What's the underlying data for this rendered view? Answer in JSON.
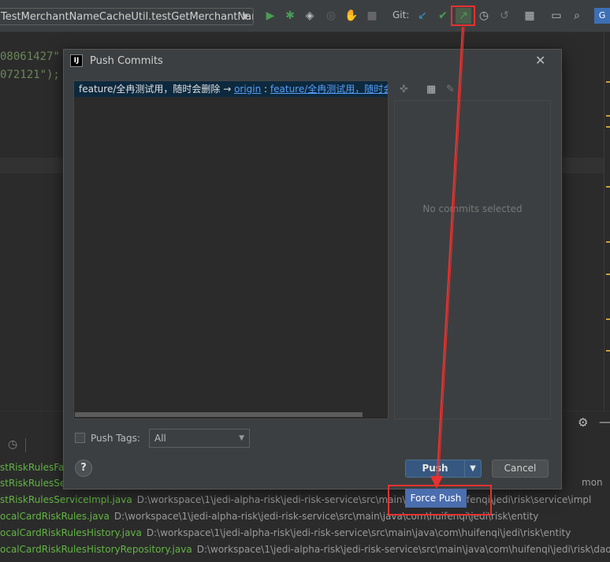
{
  "toolbar": {
    "run_config": "TestMerchantNameCacheUtil.testGetMerchantName",
    "git_label": "Git:",
    "icons": [
      "run-icon",
      "debug-icon",
      "coverage-icon",
      "profile-icon",
      "attach-icon",
      "stop-icon",
      "git-update-icon",
      "git-commit-icon",
      "git-push-icon",
      "history-icon",
      "rollback-icon",
      "project-structure-icon",
      "terminal-icon",
      "search-icon",
      "translate-icon"
    ]
  },
  "editor": {
    "line1": "08061427\"",
    "line2": "072121\");"
  },
  "bottom_files": [
    {
      "name": "stRiskRulesFa",
      "path": ""
    },
    {
      "name": "stRiskRulesSe",
      "path": ""
    },
    {
      "name": "stRiskRulesServiceImpl.java",
      "path": "D:\\workspace\\1\\jedi-alpha-risk\\jedi-risk-service\\src\\main\\java\\com\\huifenqi\\jedi\\risk\\service\\impl"
    },
    {
      "name": "ocalCardRiskRules.java",
      "path": "D:\\workspace\\1\\jedi-alpha-risk\\jedi-risk-service\\src\\main\\java\\com\\huifenqi\\jedi\\risk\\entity"
    },
    {
      "name": "ocalCardRiskRulesHistory.java",
      "path": "D:\\workspace\\1\\jedi-alpha-risk\\jedi-risk-service\\src\\main\\java\\com\\huifenqi\\jedi\\risk\\entity"
    },
    {
      "name": "ocalCardRiskRulesHistoryRepository.java",
      "path": "D:\\workspace\\1\\jedi-alpha-risk\\jedi-risk-service\\src\\main\\java\\com\\huifenqi\\jedi\\risk\\dao"
    }
  ],
  "bottom_partial": "mon",
  "dialog": {
    "title": "Push Commits",
    "app_icon": "IJ",
    "close": "✕",
    "branch_local": "feature/全冉测试用，随时会删除",
    "branch_arrow": " → ",
    "remote": "origin",
    "separator": " : ",
    "branch_remote": "feature/全冉测试用，随时会",
    "no_commits": "No commits selected",
    "push_tags_label": "Push Tags:",
    "tags_value": "All",
    "help": "?",
    "push_button": "Push",
    "cancel_button": "Cancel",
    "force_push": "Force Push"
  },
  "colors": {
    "highlight": "#e8322f",
    "selection": "#0d293e",
    "primary_button": "#365880",
    "menu_selected": "#4b6eaf"
  }
}
